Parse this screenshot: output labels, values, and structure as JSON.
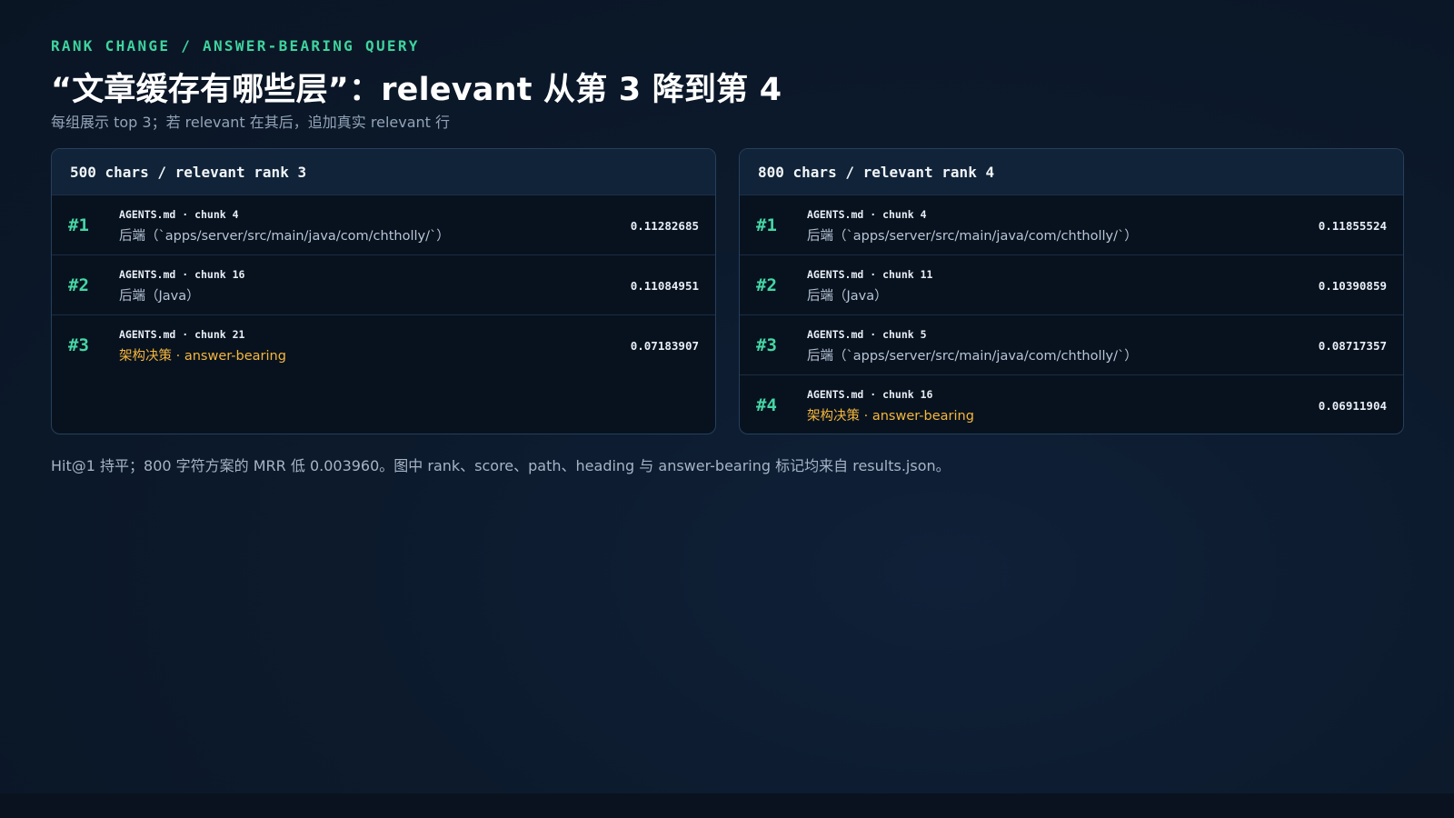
{
  "eyebrow": "RANK CHANGE / ANSWER-BEARING QUERY",
  "title": "“文章缓存有哪些层”：relevant 从第 3 降到第 4",
  "subtitle": "每组展示 top 3；若 relevant 在其后，追加真实 relevant 行",
  "panels": [
    {
      "header": "500 chars / relevant rank 3",
      "rows": [
        {
          "rank": "#1",
          "meta": "AGENTS.md · chunk 4",
          "heading": "后端（`apps/server/src/main/java/com/chtholly/`）",
          "score": "0.11282685",
          "answer_bearing": false
        },
        {
          "rank": "#2",
          "meta": "AGENTS.md · chunk 16",
          "heading": "后端（Java）",
          "score": "0.11084951",
          "answer_bearing": false
        },
        {
          "rank": "#3",
          "meta": "AGENTS.md · chunk 21",
          "heading": "架构决策 · answer-bearing",
          "score": "0.07183907",
          "answer_bearing": true
        }
      ]
    },
    {
      "header": "800 chars / relevant rank 4",
      "rows": [
        {
          "rank": "#1",
          "meta": "AGENTS.md · chunk 4",
          "heading": "后端（`apps/server/src/main/java/com/chtholly/`）",
          "score": "0.11855524",
          "answer_bearing": false
        },
        {
          "rank": "#2",
          "meta": "AGENTS.md · chunk 11",
          "heading": "后端（Java）",
          "score": "0.10390859",
          "answer_bearing": false
        },
        {
          "rank": "#3",
          "meta": "AGENTS.md · chunk 5",
          "heading": "后端（`apps/server/src/main/java/com/chtholly/`）",
          "score": "0.08717357",
          "answer_bearing": false
        },
        {
          "rank": "#4",
          "meta": "AGENTS.md · chunk 16",
          "heading": "架构决策 · answer-bearing",
          "score": "0.06911904",
          "answer_bearing": true
        }
      ]
    }
  ],
  "footnote": "Hit@1 持平；800 字符方案的 MRR 低 0.003960。图中 rank、score、path、heading 与 answer-bearing 标记均来自 results.json。",
  "colors": {
    "accent": "#3fd39e",
    "answer": "#f6b73c",
    "background": "#0b1727"
  }
}
